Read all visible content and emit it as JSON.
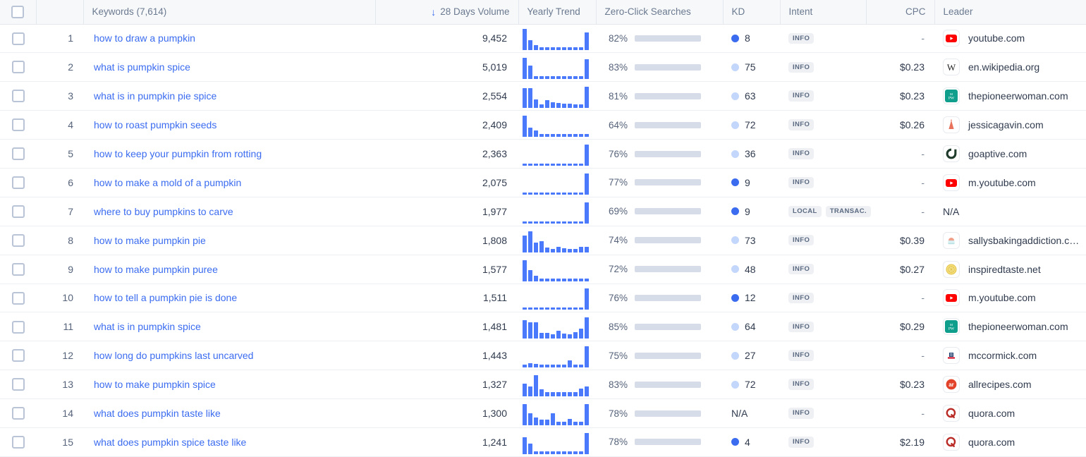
{
  "header": {
    "select_all_label": "",
    "index_label": "",
    "keywords": "Keywords (7,614)",
    "volume": "28 Days Volume",
    "sort_arrow": "↓",
    "yearly_trend": "Yearly Trend",
    "zero_click": "Zero-Click Searches",
    "kd": "KD",
    "intent": "Intent",
    "cpc": "CPC",
    "leader": "Leader"
  },
  "colors": {
    "accent_blue": "#3b6cf0",
    "spark_blue": "#4a7afb",
    "track_grey": "#d6dce8",
    "kd_easy": "#3b6cf0",
    "kd_hard": "#c3d6fb",
    "badge_bg": "#eef0f4",
    "header_bg": "#f7f8fa",
    "link_blue": "#3b6cf0"
  },
  "rows": [
    {
      "index": "1",
      "keyword": "how to draw a pumpkin",
      "volume": "9,452",
      "trend": [
        100,
        46,
        22,
        13,
        13,
        13,
        13,
        13,
        13,
        13,
        13,
        82
      ],
      "zero_click_pct": "82%",
      "zero_click_value": 82,
      "kd": "8",
      "kd_level": "easy",
      "intents": [
        "INFO"
      ],
      "cpc": "-",
      "leader": "youtube.com",
      "favicon": "youtube-favicon"
    },
    {
      "index": "2",
      "keyword": "what is pumpkin spice",
      "volume": "5,019",
      "trend": [
        100,
        62,
        12,
        12,
        12,
        12,
        12,
        12,
        12,
        12,
        12,
        93
      ],
      "zero_click_pct": "83%",
      "zero_click_value": 83,
      "kd": "75",
      "kd_level": "hard",
      "intents": [
        "INFO"
      ],
      "cpc": "$0.23",
      "leader": "en.wikipedia.org",
      "favicon": "wikipedia-favicon"
    },
    {
      "index": "3",
      "keyword": "what is in pumpkin pie spice",
      "volume": "2,554",
      "trend": [
        92,
        92,
        40,
        18,
        36,
        27,
        22,
        20,
        20,
        18,
        18,
        100
      ],
      "zero_click_pct": "81%",
      "zero_click_value": 81,
      "kd": "63",
      "kd_level": "hard",
      "intents": [
        "INFO"
      ],
      "cpc": "$0.23",
      "leader": "thepioneerwoman.com",
      "favicon": "pioneerwoman-favicon"
    },
    {
      "index": "4",
      "keyword": "how to roast pumpkin seeds",
      "volume": "2,409",
      "trend": [
        100,
        42,
        30,
        13,
        13,
        13,
        13,
        13,
        13,
        13,
        13,
        13
      ],
      "zero_click_pct": "64%",
      "zero_click_value": 64,
      "kd": "72",
      "kd_level": "hard",
      "intents": [
        "INFO"
      ],
      "cpc": "$0.26",
      "leader": "jessicagavin.com",
      "favicon": "jessicagavin-favicon"
    },
    {
      "index": "5",
      "keyword": "how to keep your pumpkin from rotting",
      "volume": "2,363",
      "trend": [
        11,
        11,
        11,
        11,
        11,
        11,
        11,
        11,
        11,
        11,
        11,
        100
      ],
      "zero_click_pct": "76%",
      "zero_click_value": 76,
      "kd": "36",
      "kd_level": "hard",
      "intents": [
        "INFO"
      ],
      "cpc": "-",
      "leader": "goaptive.com",
      "favicon": "goaptive-favicon"
    },
    {
      "index": "6",
      "keyword": "how to make a mold of a pumpkin",
      "volume": "2,075",
      "trend": [
        10,
        10,
        10,
        10,
        10,
        10,
        10,
        10,
        10,
        10,
        10,
        100
      ],
      "zero_click_pct": "77%",
      "zero_click_value": 77,
      "kd": "9",
      "kd_level": "easy",
      "intents": [
        "INFO"
      ],
      "cpc": "-",
      "leader": "m.youtube.com",
      "favicon": "youtube-favicon"
    },
    {
      "index": "7",
      "keyword": "where to buy pumpkins to carve",
      "volume": "1,977",
      "trend": [
        10,
        10,
        10,
        10,
        10,
        10,
        10,
        10,
        10,
        10,
        10,
        100
      ],
      "zero_click_pct": "69%",
      "zero_click_value": 69,
      "kd": "9",
      "kd_level": "easy",
      "intents": [
        "LOCAL",
        "TRANSAC."
      ],
      "cpc": "-",
      "leader": "N/A",
      "favicon": "none"
    },
    {
      "index": "8",
      "keyword": "how to make pumpkin pie",
      "volume": "1,808",
      "trend": [
        80,
        100,
        46,
        52,
        22,
        18,
        26,
        20,
        18,
        18,
        27,
        27
      ],
      "zero_click_pct": "74%",
      "zero_click_value": 74,
      "kd": "73",
      "kd_level": "hard",
      "intents": [
        "INFO"
      ],
      "cpc": "$0.39",
      "leader": "sallysbakingaddiction.c…",
      "favicon": "sallysbaking-favicon"
    },
    {
      "index": "9",
      "keyword": "how to make pumpkin puree",
      "volume": "1,577",
      "trend": [
        100,
        52,
        28,
        13,
        13,
        13,
        13,
        13,
        13,
        13,
        13,
        13
      ],
      "zero_click_pct": "72%",
      "zero_click_value": 72,
      "kd": "48",
      "kd_level": "hard",
      "intents": [
        "INFO"
      ],
      "cpc": "$0.27",
      "leader": "inspiredtaste.net",
      "favicon": "inspiredtaste-favicon"
    },
    {
      "index": "10",
      "keyword": "how to tell a pumpkin pie is done",
      "volume": "1,511",
      "trend": [
        11,
        11,
        11,
        11,
        11,
        11,
        11,
        11,
        11,
        11,
        11,
        100
      ],
      "zero_click_pct": "76%",
      "zero_click_value": 76,
      "kd": "12",
      "kd_level": "easy",
      "intents": [
        "INFO"
      ],
      "cpc": "-",
      "leader": "m.youtube.com",
      "favicon": "youtube-favicon"
    },
    {
      "index": "11",
      "keyword": "what is in pumpkin spice",
      "volume": "1,481",
      "trend": [
        88,
        76,
        76,
        25,
        25,
        20,
        36,
        22,
        20,
        30,
        48,
        100
      ],
      "zero_click_pct": "85%",
      "zero_click_value": 85,
      "kd": "64",
      "kd_level": "hard",
      "intents": [
        "INFO"
      ],
      "cpc": "$0.29",
      "leader": "thepioneerwoman.com",
      "favicon": "pioneerwoman-favicon"
    },
    {
      "index": "12",
      "keyword": "how long do pumpkins last uncarved",
      "volume": "1,443",
      "trend": [
        12,
        20,
        17,
        13,
        13,
        13,
        13,
        13,
        34,
        14,
        14,
        100
      ],
      "zero_click_pct": "75%",
      "zero_click_value": 75,
      "kd": "27",
      "kd_level": "hard",
      "intents": [
        "INFO"
      ],
      "cpc": "-",
      "leader": "mccormick.com",
      "favicon": "mccormick-favicon"
    },
    {
      "index": "13",
      "keyword": "how to make pumpkin spice",
      "volume": "1,327",
      "trend": [
        60,
        46,
        100,
        34,
        20,
        20,
        20,
        20,
        20,
        20,
        36,
        46
      ],
      "zero_click_pct": "83%",
      "zero_click_value": 83,
      "kd": "72",
      "kd_level": "hard",
      "intents": [
        "INFO"
      ],
      "cpc": "$0.23",
      "leader": "allrecipes.com",
      "favicon": "allrecipes-favicon"
    },
    {
      "index": "14",
      "keyword": "what does pumpkin taste like",
      "volume": "1,300",
      "trend": [
        100,
        56,
        36,
        26,
        26,
        56,
        18,
        18,
        30,
        18,
        18,
        100
      ],
      "zero_click_pct": "78%",
      "zero_click_value": 78,
      "kd": "N/A",
      "kd_level": "none",
      "intents": [
        "INFO"
      ],
      "cpc": "-",
      "leader": "quora.com",
      "favicon": "quora-favicon"
    },
    {
      "index": "15",
      "keyword": "what does pumpkin spice taste like",
      "volume": "1,241",
      "trend": [
        80,
        50,
        14,
        14,
        14,
        14,
        14,
        14,
        14,
        14,
        14,
        100
      ],
      "zero_click_pct": "78%",
      "zero_click_value": 78,
      "kd": "4",
      "kd_level": "easy",
      "intents": [
        "INFO"
      ],
      "cpc": "$2.19",
      "leader": "quora.com",
      "favicon": "quora-favicon"
    }
  ]
}
